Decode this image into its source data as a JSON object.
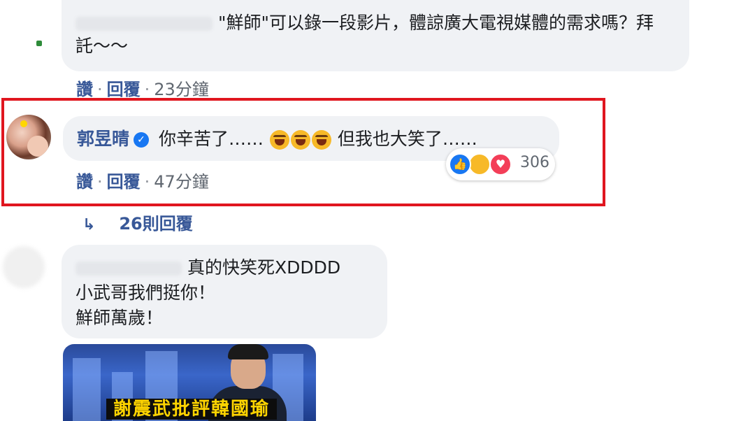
{
  "comment1": {
    "text": "\"鮮師\"可以錄一段影片，體諒廣大電視媒體的需求嗎？拜託～～",
    "like_label": "讚",
    "reply_label": "回覆",
    "time": "23分鐘"
  },
  "highlighted_comment": {
    "author": "郭昱晴",
    "text_before": "你辛苦了……",
    "text_after": "但我也大笑了……",
    "like_label": "讚",
    "reply_label": "回覆",
    "time": "47分鐘",
    "reaction_count": "306",
    "highlight_color": "#e0161f"
  },
  "replies_link": {
    "label": "26則回覆"
  },
  "comment3": {
    "line1": "真的快笑死XDDDD",
    "line2": "小武哥我們挺你！",
    "line3": "鮮師萬歲！",
    "thumbnail_caption": "謝震武批評韓國瑜"
  },
  "colors": {
    "link": "#385898",
    "bubble": "#f0f2f5",
    "verified": "#1877f2"
  }
}
